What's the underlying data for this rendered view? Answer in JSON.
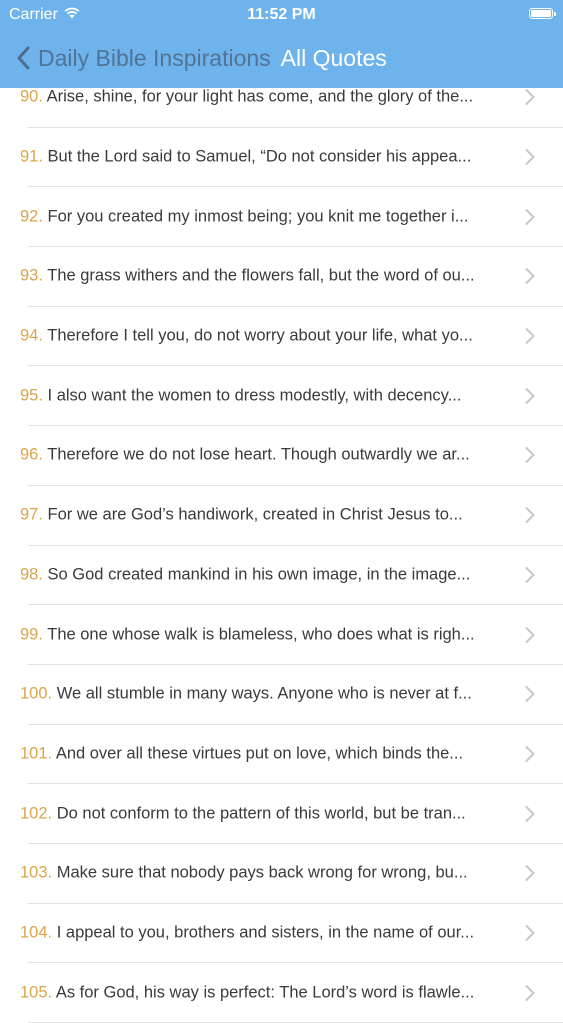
{
  "status": {
    "carrier": "Carrier",
    "time": "11:52 PM"
  },
  "nav": {
    "back_label": "Daily Bible Inspirations",
    "title": "All Quotes"
  },
  "quotes": [
    {
      "num": "90.",
      "text": "Arise, shine, for your light has come, and the glory of the..."
    },
    {
      "num": "91.",
      "text": "But the Lord said to Samuel, “Do not consider his appea..."
    },
    {
      "num": "92.",
      "text": "For you created my inmost being; you knit me together i..."
    },
    {
      "num": "93.",
      "text": "The grass withers and the flowers fall, but the word of ou..."
    },
    {
      "num": "94.",
      "text": "Therefore I tell you, do not worry about your life, what yo..."
    },
    {
      "num": "95.",
      "text": "I also want the women to dress modestly, with decency..."
    },
    {
      "num": "96.",
      "text": "Therefore we do not lose heart. Though outwardly we ar..."
    },
    {
      "num": "97.",
      "text": "For we are God’s handiwork, created in Christ Jesus to..."
    },
    {
      "num": "98.",
      "text": "So God created mankind in his own image, in the image..."
    },
    {
      "num": "99.",
      "text": "The one whose walk is blameless, who does what is righ..."
    },
    {
      "num": "100.",
      "text": "We all stumble in many ways. Anyone who is never at f..."
    },
    {
      "num": "101.",
      "text": "And over all these virtues put on love, which binds the..."
    },
    {
      "num": "102.",
      "text": "Do not conform to the pattern of this world, but be tran..."
    },
    {
      "num": "103.",
      "text": "Make sure that nobody pays back wrong for wrong, bu..."
    },
    {
      "num": "104.",
      "text": "I appeal to you, brothers and sisters, in the name of our..."
    },
    {
      "num": "105.",
      "text": "As for God, his way is perfect: The Lord’s word is flawle..."
    }
  ],
  "colors": {
    "nav_bar": "#6fb3ec",
    "number_accent": "#dba54a",
    "text": "#3a3a3a",
    "separator": "#e3e3e6",
    "chevron": "#c7c7cc"
  }
}
